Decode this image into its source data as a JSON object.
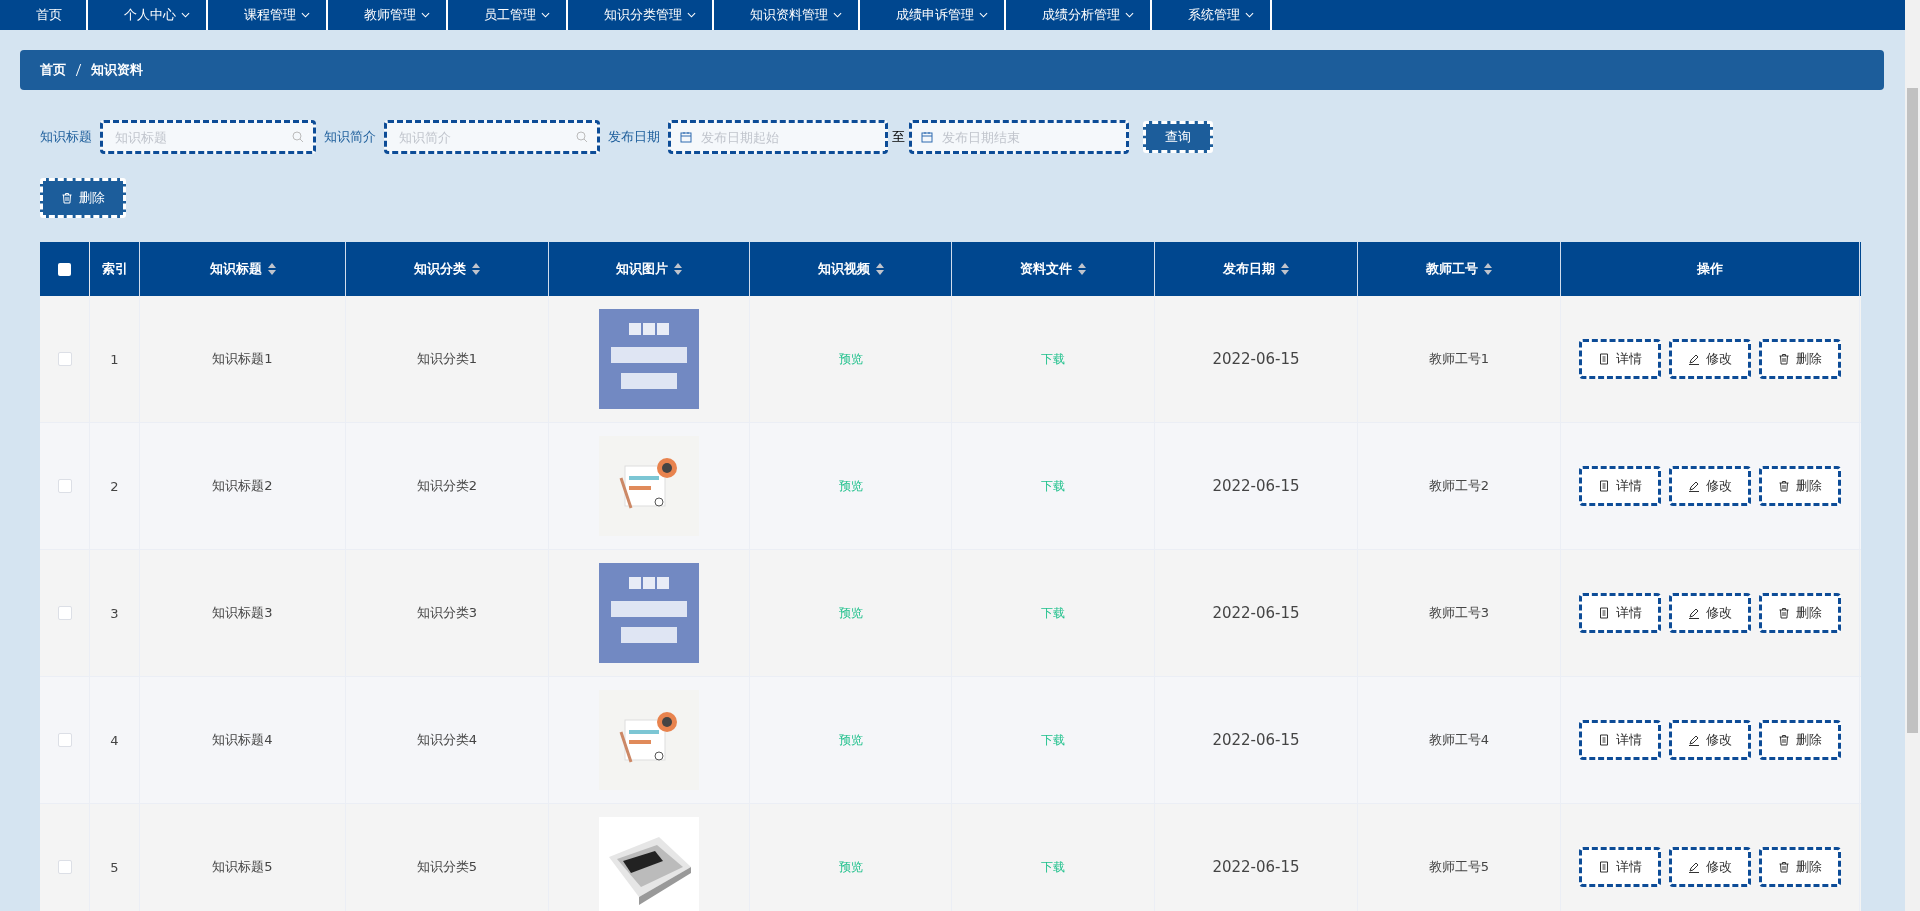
{
  "nav": [
    {
      "label": "首页",
      "dropdown": false
    },
    {
      "label": "个人中心",
      "dropdown": true
    },
    {
      "label": "课程管理",
      "dropdown": true
    },
    {
      "label": "教师管理",
      "dropdown": true
    },
    {
      "label": "员工管理",
      "dropdown": true
    },
    {
      "label": "知识分类管理",
      "dropdown": true
    },
    {
      "label": "知识资料管理",
      "dropdown": true
    },
    {
      "label": "成绩申诉管理",
      "dropdown": true
    },
    {
      "label": "成绩分析管理",
      "dropdown": true
    },
    {
      "label": "系统管理",
      "dropdown": true
    }
  ],
  "breadcrumb": [
    "首页",
    "知识资料"
  ],
  "search": {
    "fields": [
      {
        "label": "知识标题",
        "placeholder": "知识标题",
        "kind": "text"
      },
      {
        "label": "知识简介",
        "placeholder": "知识简介",
        "kind": "text"
      },
      {
        "label": "发布日期",
        "placeholder": "发布日期起始",
        "kind": "date"
      }
    ],
    "range_separator": "至",
    "date_end_placeholder": "发布日期结束",
    "button": "查询"
  },
  "delete_button": "删除",
  "table": {
    "select_all": {
      "checked": false
    },
    "columns": [
      {
        "label": "索引",
        "sortable": false
      },
      {
        "label": "知识标题",
        "sortable": true
      },
      {
        "label": "知识分类",
        "sortable": true
      },
      {
        "label": "知识图片",
        "sortable": true
      },
      {
        "label": "知识视频",
        "sortable": true
      },
      {
        "label": "资料文件",
        "sortable": true
      },
      {
        "label": "发布日期",
        "sortable": true
      },
      {
        "label": "教师工号",
        "sortable": true
      },
      {
        "label": "操作",
        "sortable": false
      }
    ],
    "rows": [
      {
        "checked": false,
        "index": "1",
        "title": "知识标题1",
        "category": "知识分类1",
        "video": "预览",
        "file": "下载",
        "date": "2022-06-15",
        "teacher": "教师工号1",
        "actions": [
          "详情",
          "修改",
          "删除"
        ]
      },
      {
        "checked": false,
        "index": "2",
        "title": "知识标题2",
        "category": "知识分类2",
        "video": "预览",
        "file": "下载",
        "date": "2022-06-15",
        "teacher": "教师工号2",
        "actions": [
          "详情",
          "修改",
          "删除"
        ]
      },
      {
        "checked": false,
        "index": "3",
        "title": "知识标题3",
        "category": "知识分类3",
        "video": "预览",
        "file": "下载",
        "date": "2022-06-15",
        "teacher": "教师工号3",
        "actions": [
          "详情",
          "修改",
          "删除"
        ]
      },
      {
        "checked": false,
        "index": "4",
        "title": "知识标题4",
        "category": "知识分类4",
        "video": "预览",
        "file": "下载",
        "date": "2022-06-15",
        "teacher": "教师工号4",
        "actions": [
          "详情",
          "修改",
          "删除"
        ]
      },
      {
        "checked": false,
        "index": "5",
        "title": "知识标题5",
        "category": "知识分类5",
        "video": "预览",
        "file": "下载",
        "date": "2022-06-15",
        "teacher": "教师工号5",
        "actions": [
          "详情",
          "修改",
          "删除"
        ]
      }
    ]
  }
}
